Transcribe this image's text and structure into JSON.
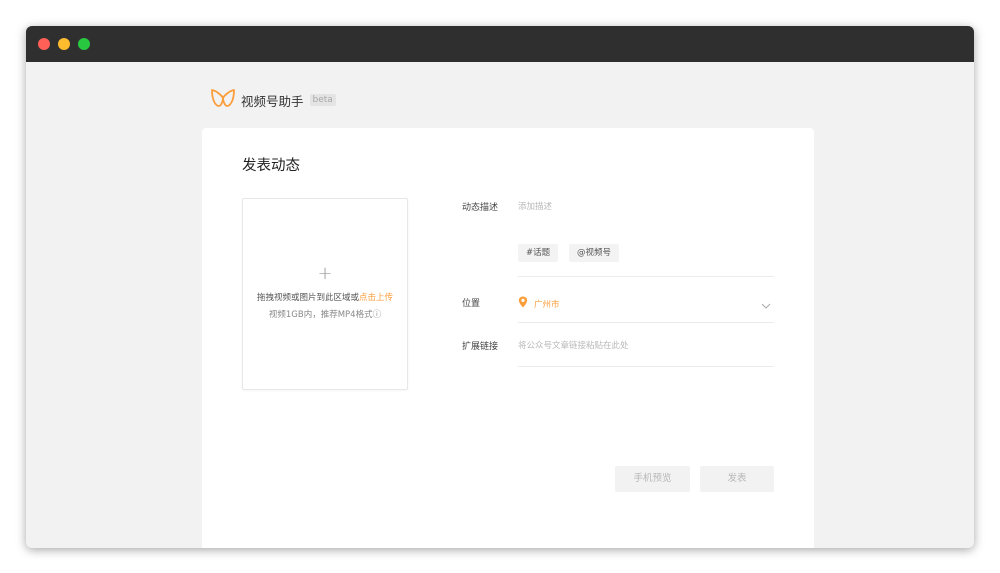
{
  "app": {
    "brand_name": "视频号助手",
    "beta_label": "beta",
    "accent_color": "#fa9d3b"
  },
  "page": {
    "title": "发表动态"
  },
  "upload": {
    "plus_glyph": "+",
    "tip_prefix": "拖拽视频或图片到此区域或",
    "tip_link": "点击上传",
    "subtip": "视频1GB内，推荐MP4格式ⓘ"
  },
  "form": {
    "description_label": "动态描述",
    "description_placeholder": "添加描述",
    "topic_button": "#话题",
    "mention_button": "@视频号",
    "location_label": "位置",
    "location_value": "广州市",
    "link_label": "扩展链接",
    "link_placeholder": "将公众号文章链接粘贴在此处"
  },
  "actions": {
    "preview_label": "手机预览",
    "publish_label": "发表"
  }
}
